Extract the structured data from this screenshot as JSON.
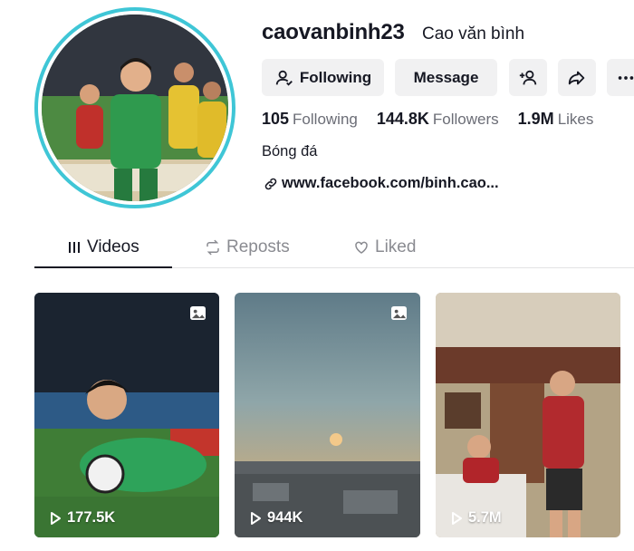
{
  "profile": {
    "username": "caovanbinh23",
    "display_name": "Cao văn bình",
    "bio": "Bóng đá",
    "link": "www.facebook.com/binh.cao..."
  },
  "actions": {
    "following_label": "Following",
    "message_label": "Message"
  },
  "stats": {
    "following_count": "105",
    "following_label": "Following",
    "followers_count": "144.8K",
    "followers_label": "Followers",
    "likes_count": "1.9M",
    "likes_label": "Likes"
  },
  "tabs": [
    {
      "label": "Videos",
      "icon": "grid-icon",
      "active": true
    },
    {
      "label": "Reposts",
      "icon": "repost-icon",
      "active": false
    },
    {
      "label": "Liked",
      "icon": "heart-icon",
      "active": false
    }
  ],
  "videos": [
    {
      "views": "177.5K",
      "photo_badge": true
    },
    {
      "views": "944K",
      "photo_badge": true
    },
    {
      "views": "5.7M",
      "photo_badge": false
    }
  ],
  "colors": {
    "avatar_ring": "#3fc6d6",
    "button_bg": "#f1f1f2",
    "text_primary": "#161823",
    "text_secondary": "#6b6d76"
  }
}
